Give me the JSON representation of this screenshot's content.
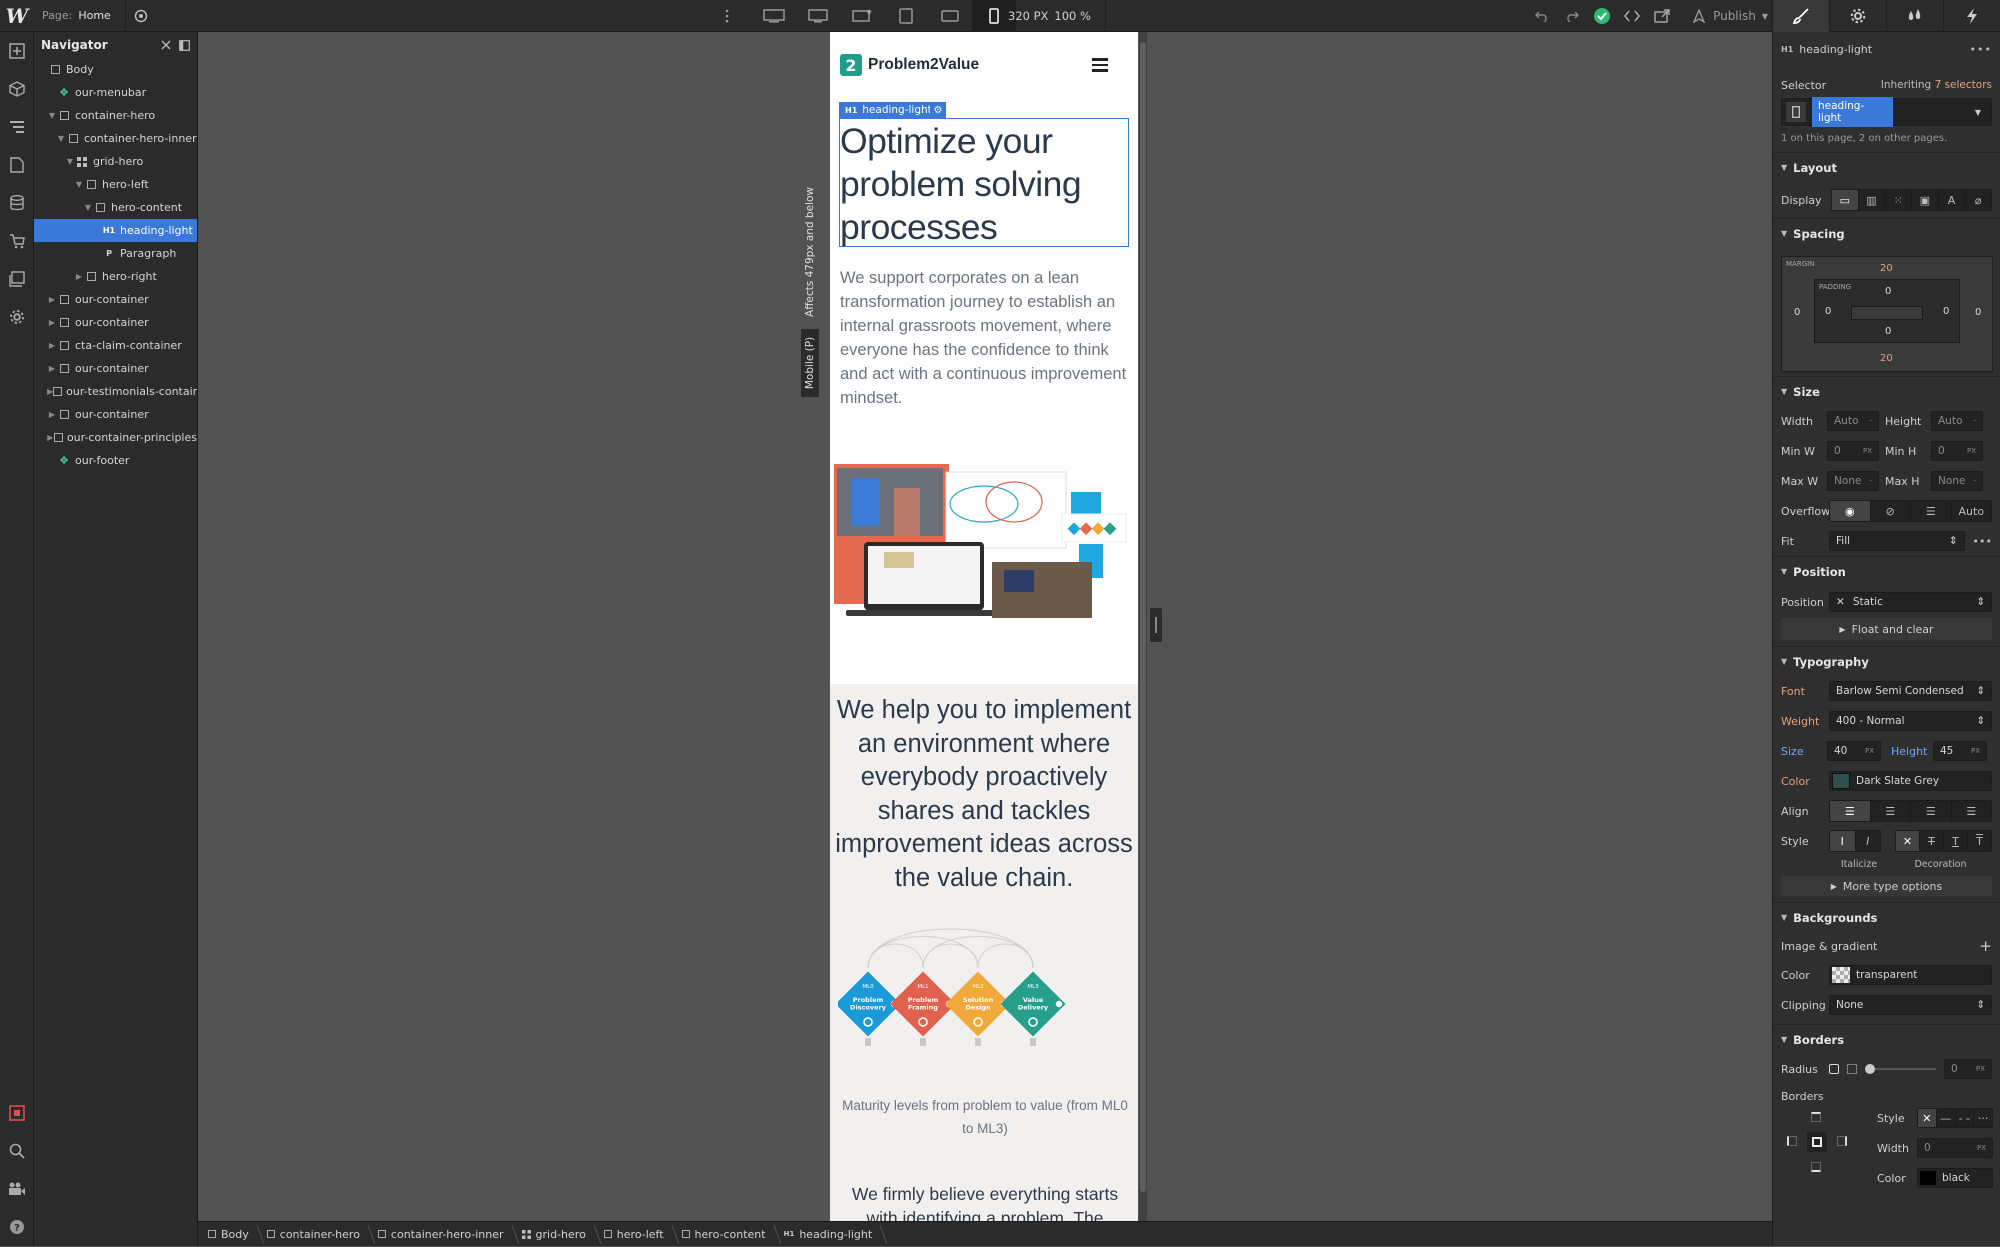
{
  "topbar": {
    "page_key": "Page:",
    "page_name": "Home",
    "canvas_width": "320 PX",
    "zoom": "100 %",
    "publish_label": "Publish"
  },
  "navigator": {
    "title": "Navigator",
    "items": [
      {
        "label": "Body",
        "depth": 0,
        "arrow": "",
        "icon": "box"
      },
      {
        "label": "our-menubar",
        "depth": 1,
        "arrow": "",
        "icon": "symbol"
      },
      {
        "label": "container-hero",
        "depth": 1,
        "arrow": "▼",
        "icon": "box"
      },
      {
        "label": "container-hero-inner",
        "depth": 2,
        "arrow": "▼",
        "icon": "box"
      },
      {
        "label": "grid-hero",
        "depth": 3,
        "arrow": "▼",
        "icon": "grid"
      },
      {
        "label": "hero-left",
        "depth": 4,
        "arrow": "▼",
        "icon": "box"
      },
      {
        "label": "hero-content",
        "depth": 5,
        "arrow": "▼",
        "icon": "box"
      },
      {
        "label": "heading-light",
        "depth": 6,
        "arrow": "",
        "icon": "H1"
      },
      {
        "label": "Paragraph",
        "depth": 6,
        "arrow": "",
        "icon": "P"
      },
      {
        "label": "hero-right",
        "depth": 4,
        "arrow": "▶",
        "icon": "box"
      },
      {
        "label": "our-container",
        "depth": 1,
        "arrow": "▶",
        "icon": "box"
      },
      {
        "label": "our-container",
        "depth": 1,
        "arrow": "▶",
        "icon": "box"
      },
      {
        "label": "cta-claim-container",
        "depth": 1,
        "arrow": "▶",
        "icon": "box"
      },
      {
        "label": "our-container",
        "depth": 1,
        "arrow": "▶",
        "icon": "box"
      },
      {
        "label": "our-testimonials-containe",
        "depth": 1,
        "arrow": "▶",
        "icon": "box"
      },
      {
        "label": "our-container",
        "depth": 1,
        "arrow": "▶",
        "icon": "box"
      },
      {
        "label": "our-container-principles",
        "depth": 1,
        "arrow": "▶",
        "icon": "box"
      },
      {
        "label": "our-footer",
        "depth": 1,
        "arrow": "",
        "icon": "symbol"
      }
    ],
    "selected_index": 7
  },
  "canvas": {
    "affects_label": "Affects 479px and below",
    "mobile_label": "Mobile (P)",
    "selection_tag": "heading-light",
    "brand_mark": "2",
    "brand_name": "Problem2Value",
    "hero_heading": "Optimize your problem solving processes",
    "hero_paragraph": "We support corporates on a lean transformation journey to establish an internal grassroots movement, where everyone has the confidence to think and act with a continuous improvement mindset.",
    "section_heading": "We help you to implement an environment where everybody proactively shares and tackles improvement ideas across the value chain.",
    "maturity_levels": [
      {
        "code": "ML0",
        "name": "Problem Discovery",
        "color": "#1a9ad6"
      },
      {
        "code": "ML1",
        "name": "Problem Framing",
        "color": "#e0614e"
      },
      {
        "code": "ML2",
        "name": "Solution Design",
        "color": "#f2a93b"
      },
      {
        "code": "ML3",
        "name": "Value Delivery",
        "color": "#26a08b"
      }
    ],
    "caption": "Maturity levels from problem to value (from ML0 to ML3)",
    "next_paragraph": "We firmly believe everything starts with identifying a problem. The"
  },
  "breadcrumbs": [
    "Body",
    "container-hero",
    "container-hero-inner",
    "grid-hero",
    "hero-left",
    "hero-content",
    "heading-light"
  ],
  "style_panel": {
    "element_name": "heading-light",
    "selector_label": "Selector",
    "inheriting_label": "Inheriting",
    "inheriting_count": "7 selectors",
    "selector_chip": "heading-light",
    "selector_note": "1 on this page, 2 on other pages.",
    "layout_title": "Layout",
    "display_label": "Display",
    "spacing_title": "Spacing",
    "margin_label": "MARGIN",
    "padding_label": "PADDING",
    "margin": {
      "top": "20",
      "right": "0",
      "bottom": "20",
      "left": "0"
    },
    "padding": {
      "top": "0",
      "right": "0",
      "bottom": "0",
      "left": "0"
    },
    "size_title": "Size",
    "width_label": "Width",
    "width_val": "Auto",
    "height_label": "Height",
    "height_val": "Auto",
    "minw_label": "Min W",
    "minw_val": "0",
    "minh_label": "Min H",
    "minh_val": "0",
    "maxw_label": "Max W",
    "maxw_val": "None",
    "maxh_label": "Max H",
    "maxh_val": "None",
    "px_unit": "PX",
    "overflow_label": "Overflow",
    "overflow_auto": "Auto",
    "fit_label": "Fit",
    "fit_val": "Fill",
    "position_title": "Position",
    "position_label": "Position",
    "position_val": "Static",
    "float_clear": "Float and clear",
    "typography_title": "Typography",
    "font_label": "Font",
    "font_val": "Barlow Semi Condensed",
    "weight_label": "Weight",
    "weight_val": "400 - Normal",
    "size_label": "Size",
    "size_val": "40",
    "lineheight_label": "Height",
    "lineheight_val": "45",
    "color_label": "Color",
    "color_val": "Dark Slate Grey",
    "color_hex": "#2f4f4f",
    "align_label": "Align",
    "style_label": "Style",
    "italicize_label": "Italicize",
    "decoration_label": "Decoration",
    "more_type": "More type options",
    "backgrounds_title": "Backgrounds",
    "image_gradient": "Image & gradient",
    "bg_color_label": "Color",
    "bg_color_val": "transparent",
    "clipping_label": "Clipping",
    "clipping_val": "None",
    "borders_title": "Borders",
    "radius_label": "Radius",
    "radius_val": "0",
    "borders_label": "Borders",
    "border_style_label": "Style",
    "border_width_label": "Width",
    "border_width_val": "0",
    "border_color_label": "Color",
    "border_color_val": "black"
  }
}
